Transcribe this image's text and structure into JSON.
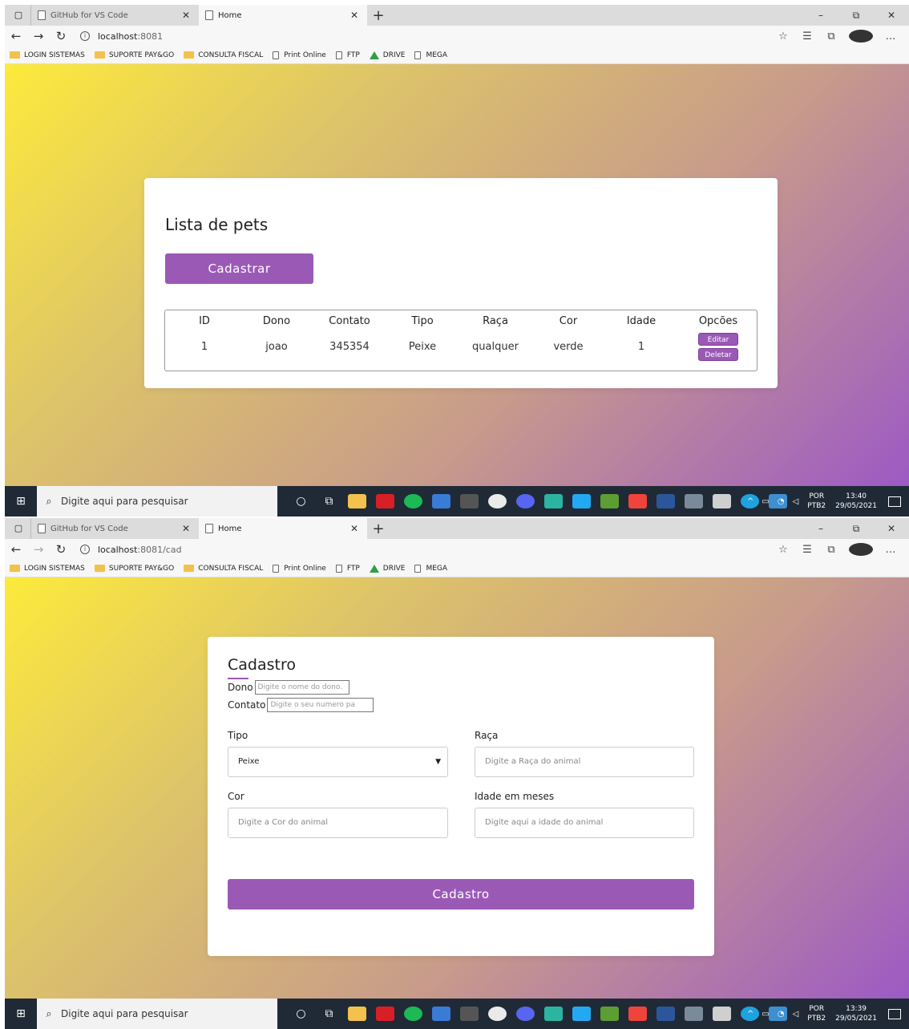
{
  "browser": {
    "tabs": [
      {
        "label": "GitHub for VS Code",
        "active": false
      },
      {
        "label": "Home",
        "active": true
      }
    ],
    "new_tab": "+",
    "window_controls": {
      "minimize": "–",
      "maximize": "⧉",
      "close": "✕"
    },
    "bookmarks": [
      {
        "label": "LOGIN SISTEMAS",
        "icon": "folder-icon"
      },
      {
        "label": "SUPORTE PAY&GO",
        "icon": "folder-icon"
      },
      {
        "label": "CONSULTA FISCAL",
        "icon": "folder-icon"
      },
      {
        "label": "Print Online",
        "icon": "page-icon"
      },
      {
        "label": "FTP",
        "icon": "page-icon"
      },
      {
        "label": "DRIVE",
        "icon": "drive-icon"
      },
      {
        "label": "MEGA",
        "icon": "page-icon"
      }
    ]
  },
  "screen1": {
    "url_host": "localhost",
    "url_rest": ":8081",
    "list": {
      "title": "Lista de pets",
      "register_button": "Cadastrar",
      "columns": [
        "ID",
        "Dono",
        "Contato",
        "Tipo",
        "Raça",
        "Cor",
        "Idade",
        "Opcões"
      ],
      "rows": [
        {
          "id": "1",
          "dono": "joao",
          "contato": "345354",
          "tipo": "Peixe",
          "raca": "qualquer",
          "cor": "verde",
          "idade": "1"
        }
      ],
      "edit_button": "Editar",
      "delete_button": "Deletar"
    },
    "taskbar": {
      "search_placeholder": "Digite aqui para pesquisar",
      "lang": "POR",
      "layout": "PTB2",
      "time": "13:40",
      "date": "29/05/2021"
    }
  },
  "screen2": {
    "url_host": "localhost",
    "url_rest": ":8081/cad",
    "form": {
      "title": "Cadastro",
      "dono_label": "Dono",
      "dono_placeholder": "Digite o nome do dono.",
      "contato_label": "Contato",
      "contato_placeholder": "Digite o seu numero pa",
      "tipo_label": "Tipo",
      "tipo_value": "Peixe",
      "raca_label": "Raça",
      "raca_placeholder": "Digite a Raça do animal",
      "cor_label": "Cor",
      "cor_placeholder": "Digite a Cor do animal",
      "idade_label": "Idade em meses",
      "idade_placeholder": "Digite aqui a idade do animal",
      "submit_button": "Cadastro"
    },
    "taskbar": {
      "search_placeholder": "Digite aqui para pesquisar",
      "lang": "POR",
      "layout": "PTB2",
      "time": "13:39",
      "date": "29/05/2021"
    }
  },
  "colors": {
    "accent": "#9b59b6",
    "gradient_start": "#fdea3b",
    "gradient_end": "#9c5ac4",
    "taskbar": "#1f2a36"
  },
  "taskbar_apps": [
    "file-explorer-icon",
    "netflix-icon",
    "spotify-icon",
    "store-icon",
    "epic-games-icon",
    "obs-icon",
    "discord-icon",
    "app-icon",
    "vscode-icon",
    "minecraft-icon",
    "anydesk-icon",
    "word-icon",
    "paint-icon",
    "terminal-icon",
    "edge-icon",
    "rdp-icon"
  ]
}
